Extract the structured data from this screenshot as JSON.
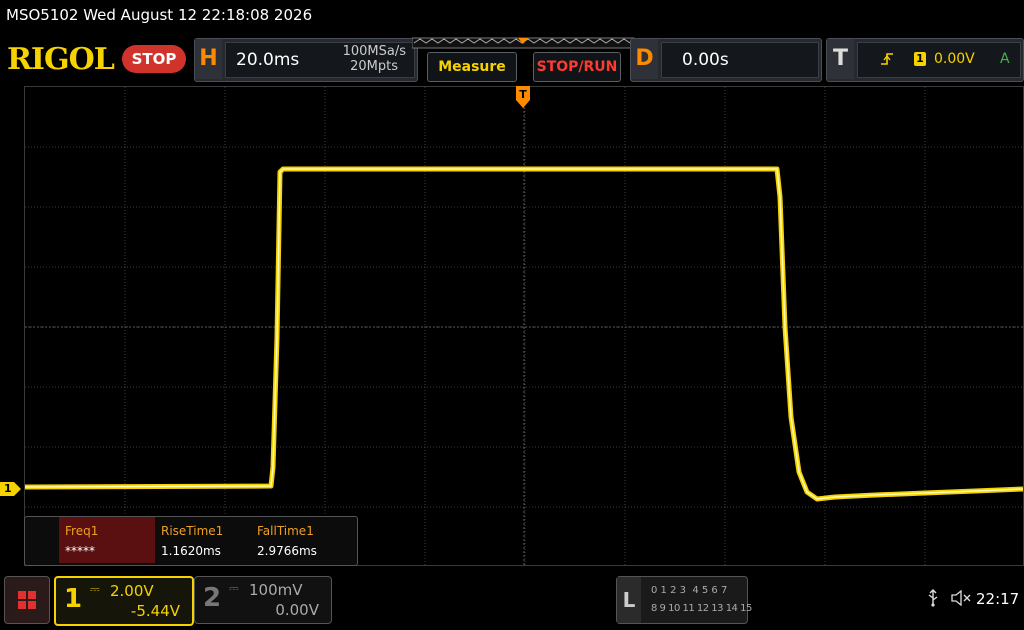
{
  "titlebar": {
    "text": "MSO5102  Wed August 12 22:18:08 2026"
  },
  "header": {
    "brand": "RIGOL",
    "run_state": "STOP",
    "horizontal": {
      "letter": "H",
      "timebase": "20.0ms",
      "sample_rate": "100MSa/s",
      "memory_depth": "20Mpts"
    },
    "measure_label": "Measure",
    "stoprun_label": "STOP/RUN",
    "delay": {
      "letter": "D",
      "value": "0.00s"
    },
    "trigger": {
      "letter": "T",
      "source": "1",
      "level": "0.00V",
      "mode": "A"
    }
  },
  "waveform": {
    "channel_marker": "1",
    "color": "#f6d200"
  },
  "measurements": [
    {
      "label": "Freq1",
      "value": "*****"
    },
    {
      "label": "RiseTime1",
      "value": "1.1620ms"
    },
    {
      "label": "FallTime1",
      "value": "2.9766ms"
    }
  ],
  "channels": [
    {
      "number": "1",
      "scale": "2.00V",
      "offset": "-5.44V",
      "coupling_symbol": "⎓",
      "color": "#f6d200"
    },
    {
      "number": "2",
      "scale": "100mV",
      "offset": "0.00V",
      "coupling_symbol": "⎓",
      "color": "#888888"
    }
  ],
  "logic": {
    "letter": "L",
    "row1": "0 1 2 3  4 5 6 7",
    "row2": "8 9 10 11 12 13 14 15"
  },
  "status": {
    "usb_icon": "usb-icon",
    "sound_icon": "speaker-muted-icon",
    "time": "22:17"
  }
}
